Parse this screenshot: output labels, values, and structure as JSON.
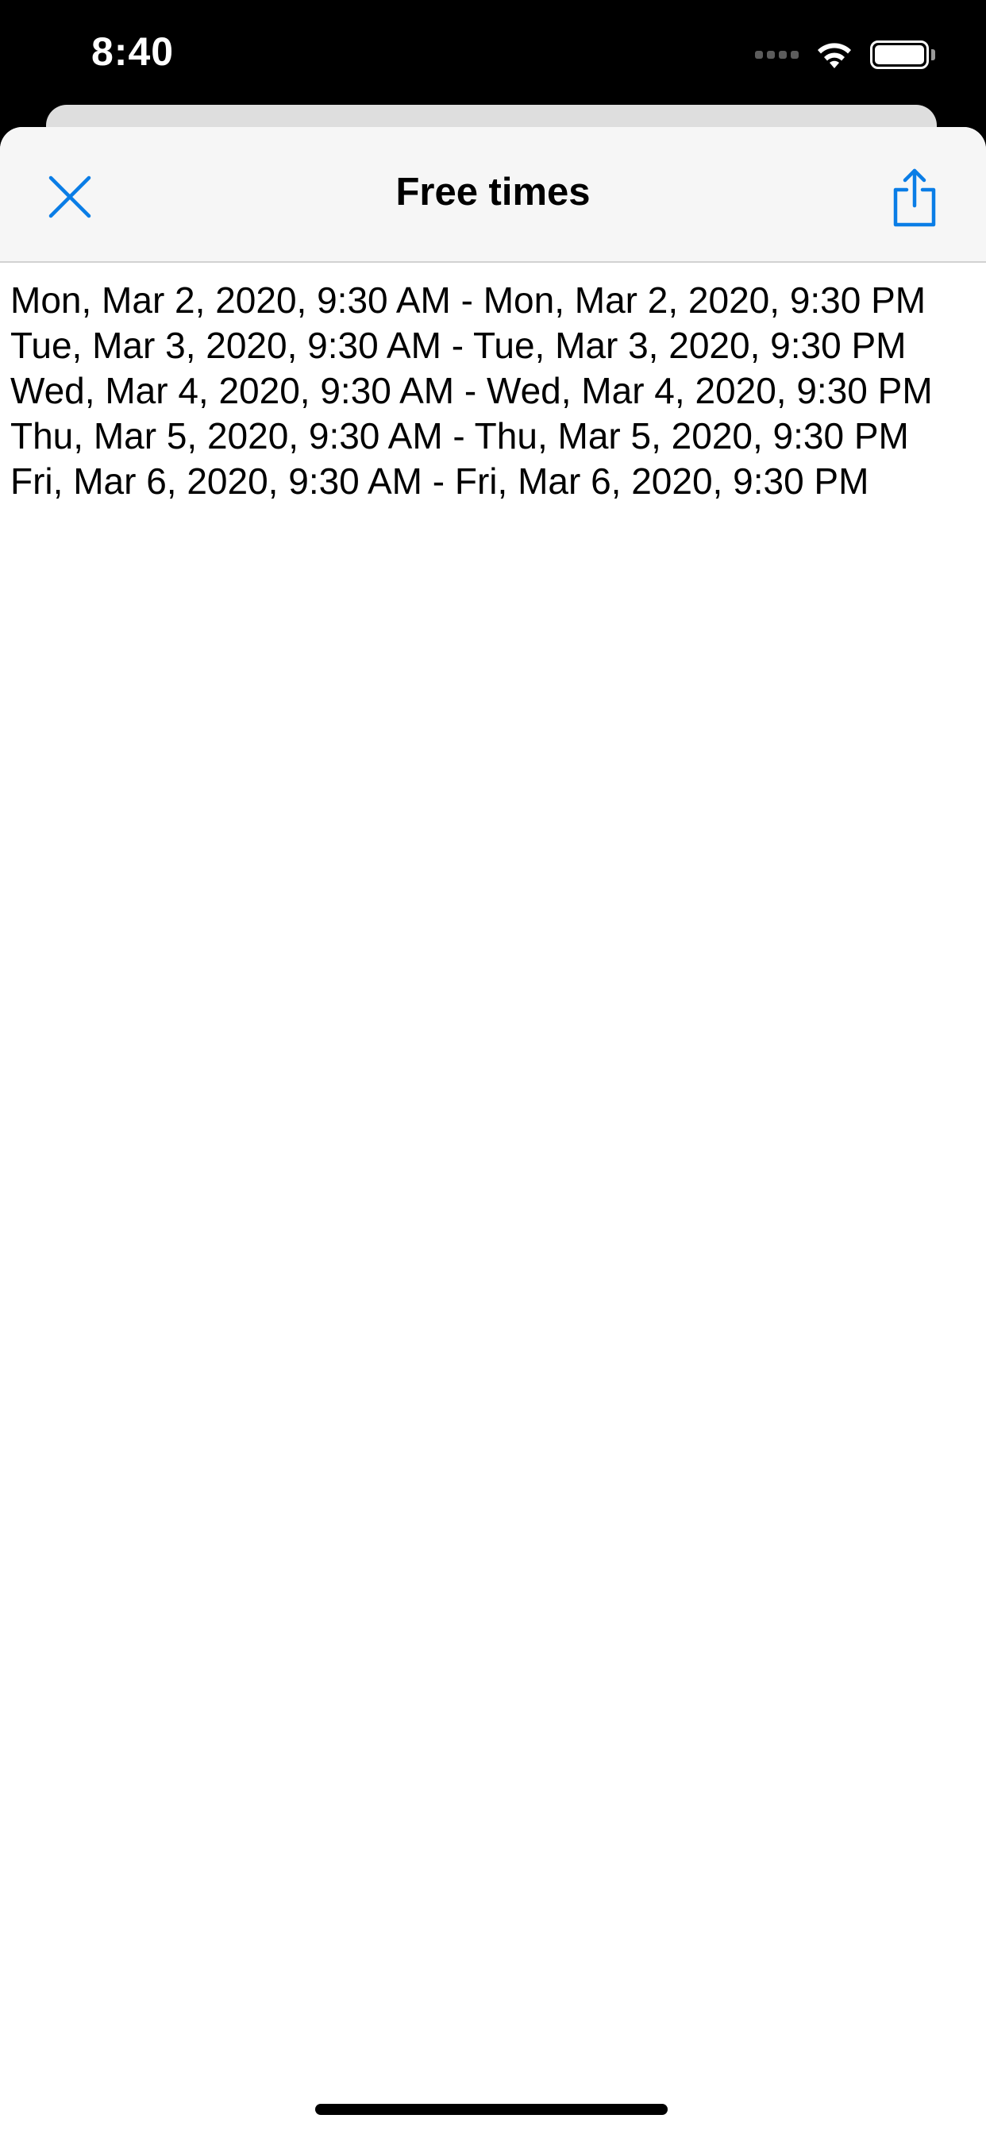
{
  "status_bar": {
    "time": "8:40",
    "icons": [
      "cellular-signal-icon",
      "wifi-icon",
      "battery-icon"
    ]
  },
  "nav_bar": {
    "title": "Free times",
    "close_icon": "close-icon",
    "share_icon": "share-icon"
  },
  "free_times": [
    "Mon, Mar 2, 2020, 9:30 AM - Mon, Mar 2, 2020, 9:30 PM",
    "Tue, Mar 3, 2020, 9:30 AM - Tue, Mar 3, 2020, 9:30 PM",
    "Wed, Mar 4, 2020, 9:30 AM - Wed, Mar 4, 2020, 9:30 PM",
    "Thu, Mar 5, 2020, 9:30 AM - Thu, Mar 5, 2020, 9:30 PM",
    "Fri, Mar 6, 2020, 9:30 AM - Fri, Mar 6, 2020, 9:30 PM"
  ],
  "colors": {
    "accent": "#0a7de6",
    "nav_background": "#f6f6f6",
    "status_background": "#000000",
    "text": "#000000"
  }
}
